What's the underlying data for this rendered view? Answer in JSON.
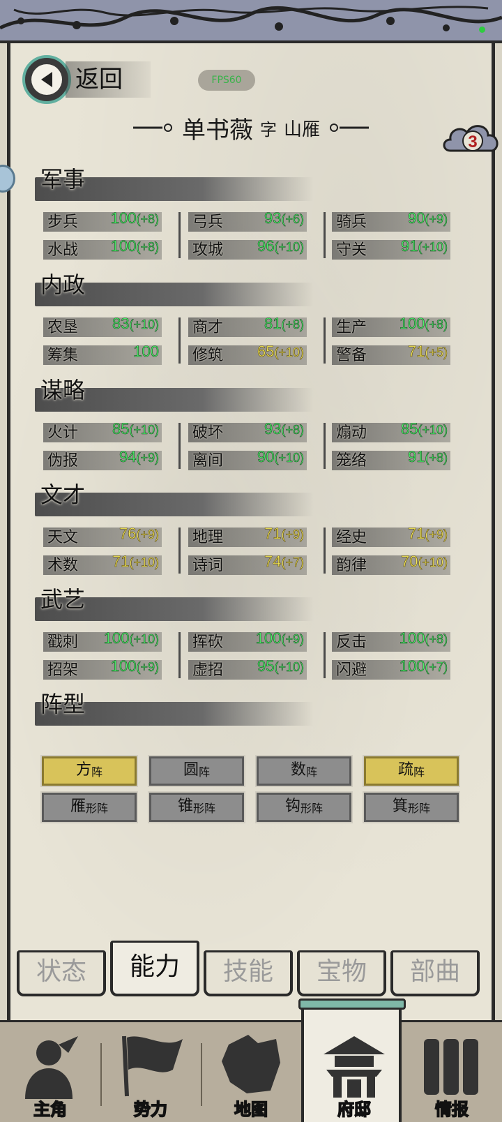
{
  "header": {
    "back_label": "返回",
    "fps_label": "FPS60",
    "name": "单书薇",
    "zi_label": "字",
    "courtesy_name": "山雁",
    "badge_count": "3"
  },
  "sections": [
    {
      "title": "军事",
      "rows": [
        [
          {
            "label": "步兵",
            "value": "100",
            "bonus": "(+8)",
            "color": "green"
          },
          {
            "label": "弓兵",
            "value": "93",
            "bonus": "(+6)",
            "color": "green"
          },
          {
            "label": "骑兵",
            "value": "90",
            "bonus": "(+9)",
            "color": "green"
          }
        ],
        [
          {
            "label": "水战",
            "value": "100",
            "bonus": "(+8)",
            "color": "green"
          },
          {
            "label": "攻城",
            "value": "96",
            "bonus": "(+10)",
            "color": "green"
          },
          {
            "label": "守关",
            "value": "91",
            "bonus": "(+10)",
            "color": "green"
          }
        ]
      ]
    },
    {
      "title": "内政",
      "rows": [
        [
          {
            "label": "农垦",
            "value": "83",
            "bonus": "(+10)",
            "color": "green"
          },
          {
            "label": "商才",
            "value": "81",
            "bonus": "(+8)",
            "color": "green"
          },
          {
            "label": "生产",
            "value": "100",
            "bonus": "(+8)",
            "color": "green"
          }
        ],
        [
          {
            "label": "筹集",
            "value": "100",
            "bonus": "",
            "color": "green"
          },
          {
            "label": "修筑",
            "value": "65",
            "bonus": "(+10)",
            "color": "yellow"
          },
          {
            "label": "警备",
            "value": "71",
            "bonus": "(+5)",
            "color": "yellow"
          }
        ]
      ]
    },
    {
      "title": "谋略",
      "rows": [
        [
          {
            "label": "火计",
            "value": "85",
            "bonus": "(+10)",
            "color": "green"
          },
          {
            "label": "破坏",
            "value": "93",
            "bonus": "(+8)",
            "color": "green"
          },
          {
            "label": "煽动",
            "value": "85",
            "bonus": "(+10)",
            "color": "green"
          }
        ],
        [
          {
            "label": "伪报",
            "value": "94",
            "bonus": "(+9)",
            "color": "green"
          },
          {
            "label": "离间",
            "value": "90",
            "bonus": "(+10)",
            "color": "green"
          },
          {
            "label": "笼络",
            "value": "91",
            "bonus": "(+8)",
            "color": "green"
          }
        ]
      ]
    },
    {
      "title": "文才",
      "rows": [
        [
          {
            "label": "天文",
            "value": "76",
            "bonus": "(+9)",
            "color": "yellow"
          },
          {
            "label": "地理",
            "value": "71",
            "bonus": "(+9)",
            "color": "yellow"
          },
          {
            "label": "经史",
            "value": "71",
            "bonus": "(+9)",
            "color": "yellow"
          }
        ],
        [
          {
            "label": "术数",
            "value": "71",
            "bonus": "(+10)",
            "color": "yellow"
          },
          {
            "label": "诗词",
            "value": "74",
            "bonus": "(+7)",
            "color": "yellow"
          },
          {
            "label": "韵律",
            "value": "70",
            "bonus": "(+10)",
            "color": "yellow"
          }
        ]
      ]
    },
    {
      "title": "武艺",
      "rows": [
        [
          {
            "label": "戳刺",
            "value": "100",
            "bonus": "(+10)",
            "color": "green"
          },
          {
            "label": "挥砍",
            "value": "100",
            "bonus": "(+9)",
            "color": "green"
          },
          {
            "label": "反击",
            "value": "100",
            "bonus": "(+8)",
            "color": "green"
          }
        ],
        [
          {
            "label": "招架",
            "value": "100",
            "bonus": "(+9)",
            "color": "green"
          },
          {
            "label": "虚招",
            "value": "95",
            "bonus": "(+10)",
            "color": "green"
          },
          {
            "label": "闪避",
            "value": "100",
            "bonus": "(+7)",
            "color": "green"
          }
        ]
      ]
    },
    {
      "title": "阵型",
      "rows": []
    }
  ],
  "formations": [
    [
      {
        "main": "方",
        "suffix": "阵",
        "active": true
      },
      {
        "main": "圆",
        "suffix": "阵",
        "active": false
      },
      {
        "main": "数",
        "suffix": "阵",
        "active": false
      },
      {
        "main": "疏",
        "suffix": "阵",
        "active": true
      }
    ],
    [
      {
        "main": "雁",
        "suffix": "形阵",
        "active": false
      },
      {
        "main": "锥",
        "suffix": "形阵",
        "active": false
      },
      {
        "main": "钩",
        "suffix": "形阵",
        "active": false
      },
      {
        "main": "箕",
        "suffix": "形阵",
        "active": false
      }
    ]
  ],
  "sub_tabs": [
    {
      "label": "状态",
      "active": false
    },
    {
      "label": "能力",
      "active": true
    },
    {
      "label": "技能",
      "active": false
    },
    {
      "label": "宝物",
      "active": false
    },
    {
      "label": "部曲",
      "active": false
    }
  ],
  "bottom_nav": [
    {
      "label": "主角",
      "icon": "warrior-icon",
      "active": false
    },
    {
      "label": "势力",
      "icon": "flag-icon",
      "active": false
    },
    {
      "label": "地图",
      "icon": "map-icon",
      "active": false
    },
    {
      "label": "府邸",
      "icon": "mansion-icon",
      "active": true
    },
    {
      "label": "情报",
      "icon": "scroll-icon",
      "active": false
    }
  ],
  "colors": {
    "stat_green": "#4cf36a",
    "stat_yellow": "#f5ea5a",
    "formation_active": "#d8c35a",
    "formation_inactive": "#8d8d8d",
    "top_band": "#8f94aa",
    "accent_teal": "#62b0a0"
  }
}
